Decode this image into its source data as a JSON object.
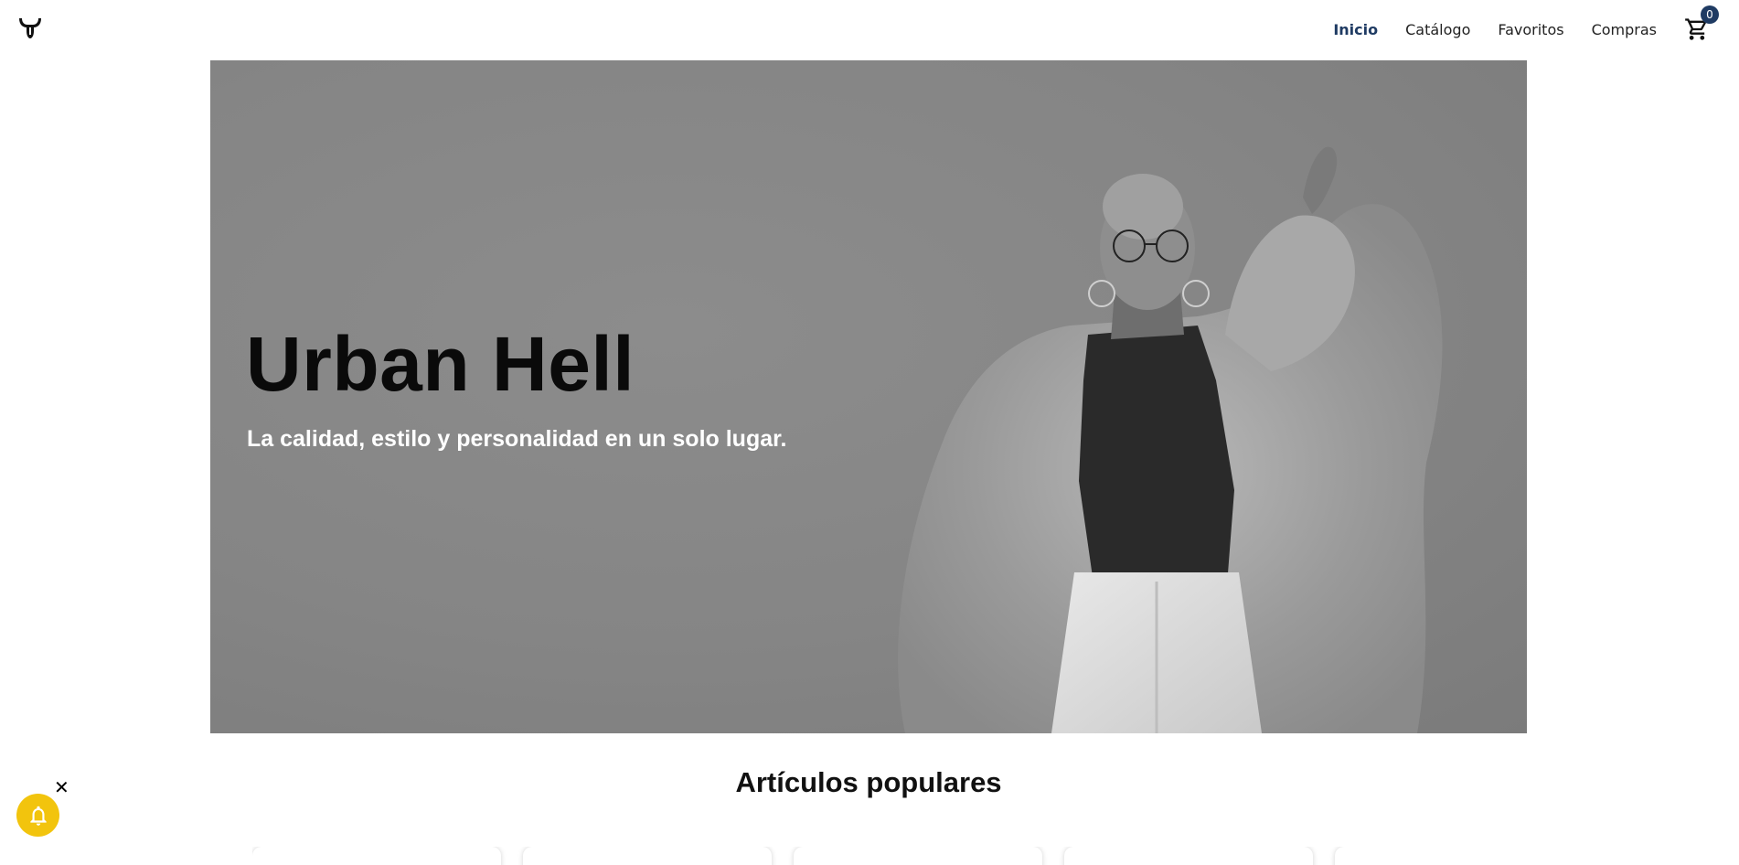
{
  "header": {
    "logo_icon": "bull-horns-logo-icon",
    "nav": [
      {
        "label": "Inicio",
        "active": true
      },
      {
        "label": "Catálogo",
        "active": false
      },
      {
        "label": "Favoritos",
        "active": false
      },
      {
        "label": "Compras",
        "active": false
      }
    ],
    "cart": {
      "icon": "cart-icon",
      "count": "0"
    }
  },
  "hero": {
    "title": "Urban Hell",
    "subtitle": "La calidad, estilo y personalidad en un solo lugar."
  },
  "popular": {
    "title": "Artículos populares"
  },
  "notification": {
    "icon": "bell-icon",
    "close_label": "✕"
  },
  "colors": {
    "accent": "#1f3b63",
    "notification_bg": "#f2c40d"
  }
}
